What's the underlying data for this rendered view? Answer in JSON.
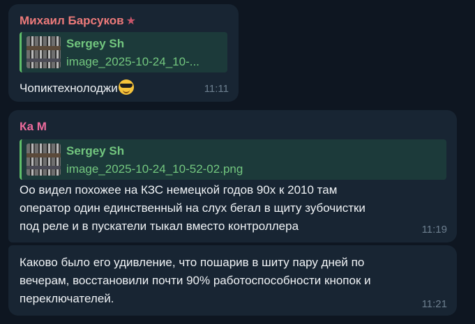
{
  "messages": [
    {
      "sender": "Михаил Барсуков",
      "sender_icon": "star-icon",
      "reply": {
        "name": "Sergey Sh",
        "file": "image_2025-10-24_10-..."
      },
      "text": "Чопиктехнолоджи",
      "emoji": "sunglasses-emoji",
      "time": "11:11"
    },
    {
      "sender": "Ка М",
      "reply": {
        "name": "Sergey Sh",
        "file": "image_2025-10-24_10-52-02.png"
      },
      "lines": [
        "Оо видел похожее на КЗС немецкой годов 90х к 2010 там",
        "оператор один единственный на слух бегал в щиту  зубочистки",
        "под реле и в пускатели тыкал вместо контроллера"
      ],
      "time": "11:19"
    },
    {
      "lines": [
        "Каково было его удивление, что пошарив в шиту пару дней по",
        "вечерам, восстановили почти 90% работоспособности кнопок и",
        "переключателей."
      ],
      "time": "11:21"
    }
  ],
  "colors": {
    "background": "#0e1621",
    "bubble": "#182533",
    "sender_1": "#ec7a7a",
    "sender_2": "#ee6b9d",
    "reply_accent": "#73c77f",
    "time": "#6d7f8f"
  }
}
